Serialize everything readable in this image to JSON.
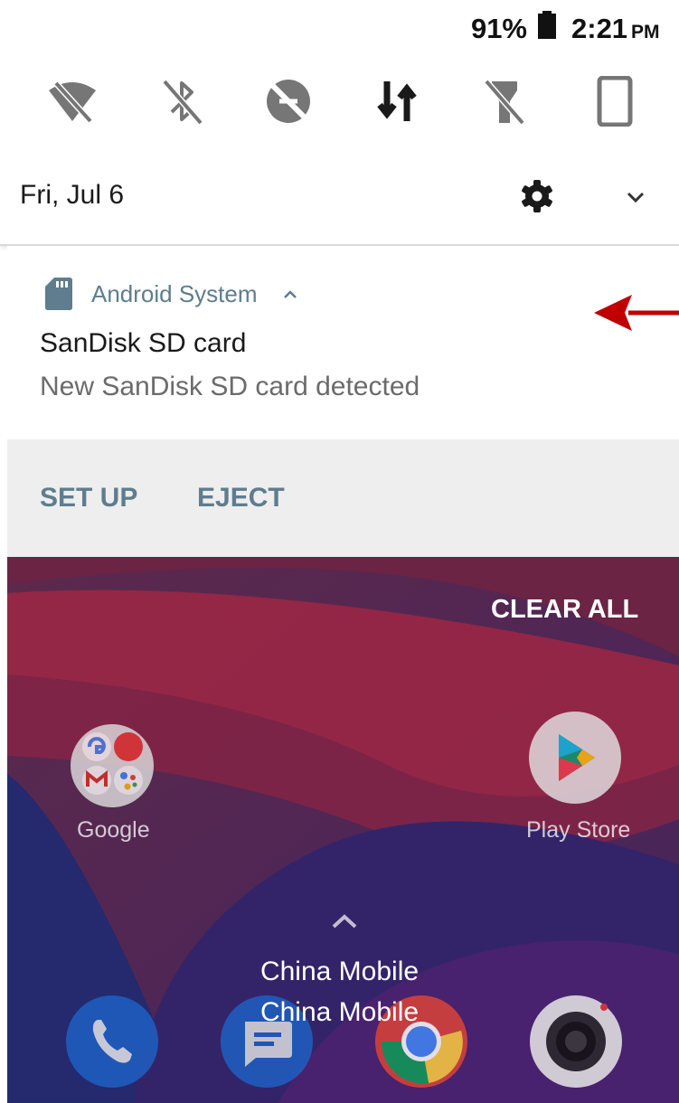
{
  "status_bar": {
    "battery_percent": "91%",
    "time": "2:21",
    "ampm": "PM"
  },
  "quick_settings": {
    "tiles": [
      "wifi-off-icon",
      "bluetooth-off-icon",
      "data-saver-off-icon",
      "mobile-data-icon",
      "flashlight-off-icon",
      "auto-rotate-icon"
    ]
  },
  "header": {
    "date": "Fri, Jul 6"
  },
  "notification": {
    "app_name": "Android System",
    "title": "SanDisk SD card",
    "text": "New SanDisk SD card detected",
    "actions": [
      "SET UP",
      "EJECT"
    ],
    "arrow_color": "#c00000"
  },
  "home": {
    "clear_all": "CLEAR ALL",
    "apps": [
      "Google",
      "Play Store"
    ],
    "carrier_lines": [
      "China Mobile",
      "China Mobile"
    ]
  }
}
